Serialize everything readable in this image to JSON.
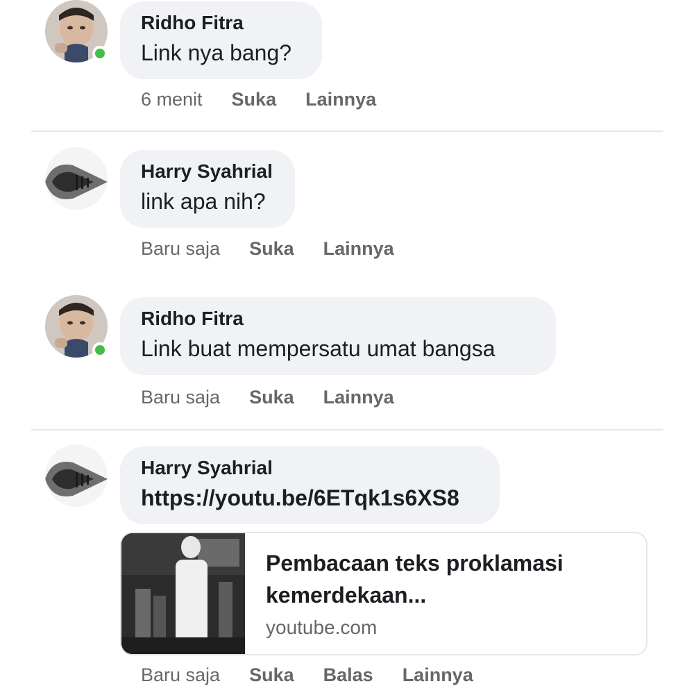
{
  "comments": [
    {
      "author": "Ridho Fitra",
      "text": "Link nya bang?",
      "time": "6 menit",
      "actions": [
        "Suka",
        "Lainnya"
      ],
      "online": true
    },
    {
      "author": "Harry Syahrial",
      "text": "link apa nih?",
      "time": "Baru saja",
      "actions": [
        "Suka",
        "Lainnya"
      ],
      "online": false
    },
    {
      "author": "Ridho Fitra",
      "text": "Link buat mempersatu umat bangsa",
      "time": "Baru saja",
      "actions": [
        "Suka",
        "Lainnya"
      ],
      "online": true
    },
    {
      "author": "Harry Syahrial",
      "text": "https://youtu.be/6ETqk1s6XS8",
      "time": "Baru saja",
      "actions": [
        "Suka",
        "Balas",
        "Lainnya"
      ],
      "online": false
    }
  ],
  "link_preview": {
    "title": "Pembacaan teks proklamasi kemerdekaan...",
    "domain": "youtube.com"
  },
  "colors": {
    "bubble": "#f0f2f5",
    "online": "#44bd4a",
    "meta_text": "#65676b"
  }
}
